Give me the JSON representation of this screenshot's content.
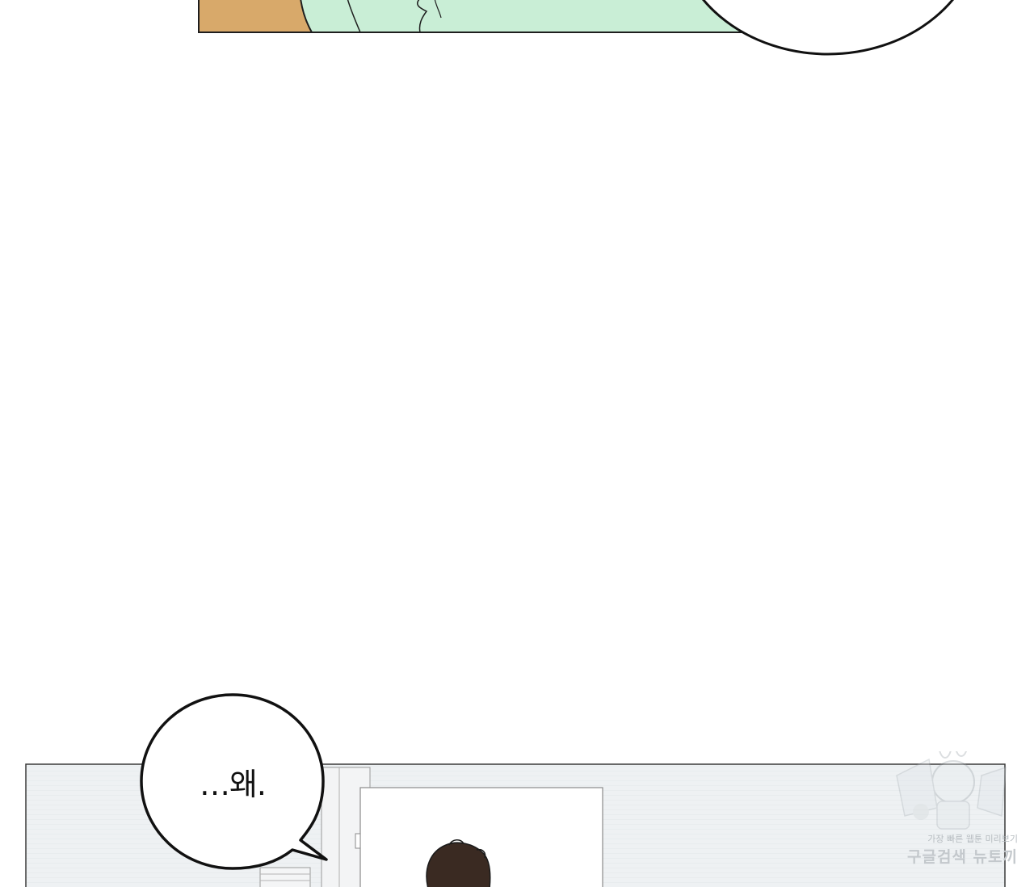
{
  "panels": {
    "top": {
      "description_colors": {
        "skin": "#d8a96a",
        "shirt": "#c9eed6",
        "ink": "#1e1e1e"
      }
    },
    "bottom": {
      "colors": {
        "wall": "#eef1f3",
        "door": "#ffffff",
        "hair": "#3a2a22",
        "ink": "#1a1a1a"
      }
    }
  },
  "dialogue": {
    "bubble_text": "…왜."
  },
  "watermark": {
    "line1": "가장 빠른 웹툰 미리보기",
    "line2": "구글검색 뉴토끼",
    "icon": "bunny-mascot-icon"
  }
}
